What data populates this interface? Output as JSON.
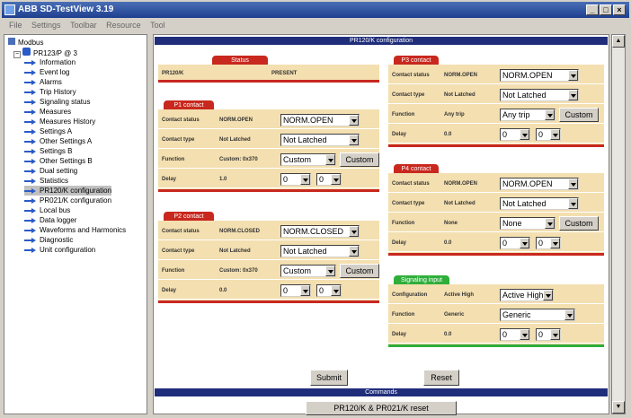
{
  "window": {
    "title": "ABB SD-TestView 3.19",
    "menu": [
      "File",
      "Settings",
      "Toolbar",
      "Resource",
      "Tool"
    ]
  },
  "tree": {
    "root": "Modbus",
    "device": "PR123/P @ 3",
    "items": [
      "Information",
      "Event log",
      "Alarms",
      "Trip History",
      "Signaling status",
      "Measures",
      "Measures History",
      "Settings A",
      "Other Settings A",
      "Settings B",
      "Other Settings B",
      "Dual setting",
      "Statistics",
      "PR120/K configuration",
      "PR021/K configuration",
      "Local bus",
      "Data logger",
      "Waveforms and Harmonics",
      "Diagnostic",
      "Unit configuration"
    ]
  },
  "content": {
    "header": "PR120/K configuration"
  },
  "status": {
    "title": "Status",
    "label": "PR120/K",
    "value": "PRESENT"
  },
  "p1": {
    "title": "P1 contact",
    "rows": [
      {
        "label": "Contact status",
        "value": "NORM.OPEN",
        "select": "NORM.OPEN"
      },
      {
        "label": "Contact type",
        "value": "Not Latched",
        "select": "Not Latched"
      },
      {
        "label": "Function",
        "value": "Custom: 0x370",
        "select": "Custom",
        "button": "Custom"
      },
      {
        "label": "Delay",
        "value": "1.0",
        "select": "0",
        "select2": "0"
      }
    ]
  },
  "p2": {
    "title": "P2 contact",
    "rows": [
      {
        "label": "Contact status",
        "value": "NORM.CLOSED",
        "select": "NORM.CLOSED"
      },
      {
        "label": "Contact type",
        "value": "Not Latched",
        "select": "Not Latched"
      },
      {
        "label": "Function",
        "value": "Custom: 0x370",
        "select": "Custom",
        "button": "Custom"
      },
      {
        "label": "Delay",
        "value": "0.0",
        "select": "0",
        "select2": "0"
      }
    ]
  },
  "p3": {
    "title": "P3 contact",
    "rows": [
      {
        "label": "Contact status",
        "value": "NORM.OPEN",
        "select": "NORM.OPEN"
      },
      {
        "label": "Contact type",
        "value": "Not Latched",
        "select": "Not Latched"
      },
      {
        "label": "Function",
        "value": "Any trip",
        "select": "Any trip",
        "button": "Custom"
      },
      {
        "label": "Delay",
        "value": "0.0",
        "select": "0",
        "select2": "0"
      }
    ]
  },
  "p4": {
    "title": "P4 contact",
    "rows": [
      {
        "label": "Contact status",
        "value": "NORM.OPEN",
        "select": "NORM.OPEN"
      },
      {
        "label": "Contact type",
        "value": "Not Latched",
        "select": "Not Latched"
      },
      {
        "label": "Function",
        "value": "None",
        "select": "None",
        "button": "Custom"
      },
      {
        "label": "Delay",
        "value": "0.0",
        "select": "0",
        "select2": "0"
      }
    ]
  },
  "input": {
    "title": "Signaling input",
    "rows": [
      {
        "label": "Configuration",
        "value": "Active High",
        "select": "Active High"
      },
      {
        "label": "Function",
        "value": "Generic",
        "select": "Generic"
      },
      {
        "label": "Delay",
        "value": "0.0",
        "select": "0",
        "select2": "0"
      }
    ]
  },
  "actions": {
    "submit": "Submit",
    "reset": "Reset"
  },
  "commands": {
    "header": "Commands",
    "button": "PR120/K & PR021/K reset"
  },
  "colors": {
    "header": "#1f2d7a",
    "red": "#c8281e",
    "green": "#2fae3a",
    "panel": "#f3dfb0"
  }
}
